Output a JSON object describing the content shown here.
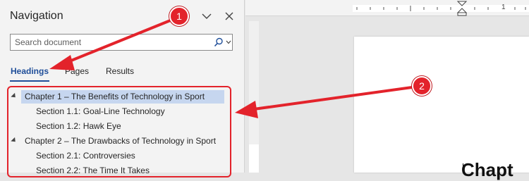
{
  "navigation": {
    "title": "Navigation",
    "search_placeholder": "Search document",
    "tabs": [
      {
        "label": "Headings",
        "active": true
      },
      {
        "label": "Pages",
        "active": false
      },
      {
        "label": "Results",
        "active": false
      }
    ],
    "headings": [
      {
        "label": "Chapter 1 – The Benefits of Technology in Sport",
        "level": 1,
        "expanded": true,
        "selected": true
      },
      {
        "label": "Section 1.1: Goal-Line Technology",
        "level": 2
      },
      {
        "label": "Section 1.2: Hawk Eye",
        "level": 2
      },
      {
        "label": "Chapter 2 – The Drawbacks of Technology in Sport",
        "level": 1,
        "expanded": true,
        "selected": false
      },
      {
        "label": "Section 2.1: Controversies",
        "level": 2
      },
      {
        "label": "Section 2.2: The Time It Takes",
        "level": 2
      }
    ]
  },
  "ruler": {
    "number": "1"
  },
  "document": {
    "visible_heading": "Chapt"
  },
  "annotations": {
    "badge_1": "1",
    "badge_2": "2",
    "color": "#e3232b"
  },
  "colors": {
    "accent": "#1f4e99",
    "selection": "#c6d6ef"
  }
}
